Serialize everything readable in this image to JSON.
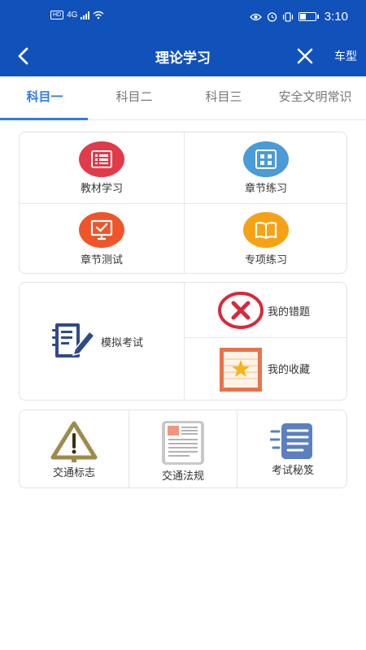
{
  "status_bar": {
    "network": "4G",
    "time": "3:10"
  },
  "nav": {
    "title": "理论学习",
    "right_label": "车型"
  },
  "tabs": [
    {
      "label": "科目一",
      "active": true
    },
    {
      "label": "科目二",
      "active": false
    },
    {
      "label": "科目三",
      "active": false
    },
    {
      "label": "安全文明常识",
      "active": false
    }
  ],
  "study_grid": {
    "items": [
      {
        "label": "教材学习",
        "icon": "textbook-icon",
        "color": "#e23a48"
      },
      {
        "label": "章节练习",
        "icon": "grid-icon",
        "color": "#4a9bd6"
      },
      {
        "label": "章节测试",
        "icon": "monitor-check-icon",
        "color": "#f0542b"
      },
      {
        "label": "专项练习",
        "icon": "book-icon",
        "color": "#f6a215"
      }
    ]
  },
  "exam_block": {
    "main_label": "模拟考试",
    "wrong_label": "我的错题",
    "favorites_label": "我的收藏"
  },
  "resources": {
    "items": [
      {
        "label": "交通标志",
        "icon": "warning-sign-icon"
      },
      {
        "label": "交通法规",
        "icon": "document-icon"
      },
      {
        "label": "考试秘笈",
        "icon": "fast-notes-icon"
      }
    ]
  }
}
